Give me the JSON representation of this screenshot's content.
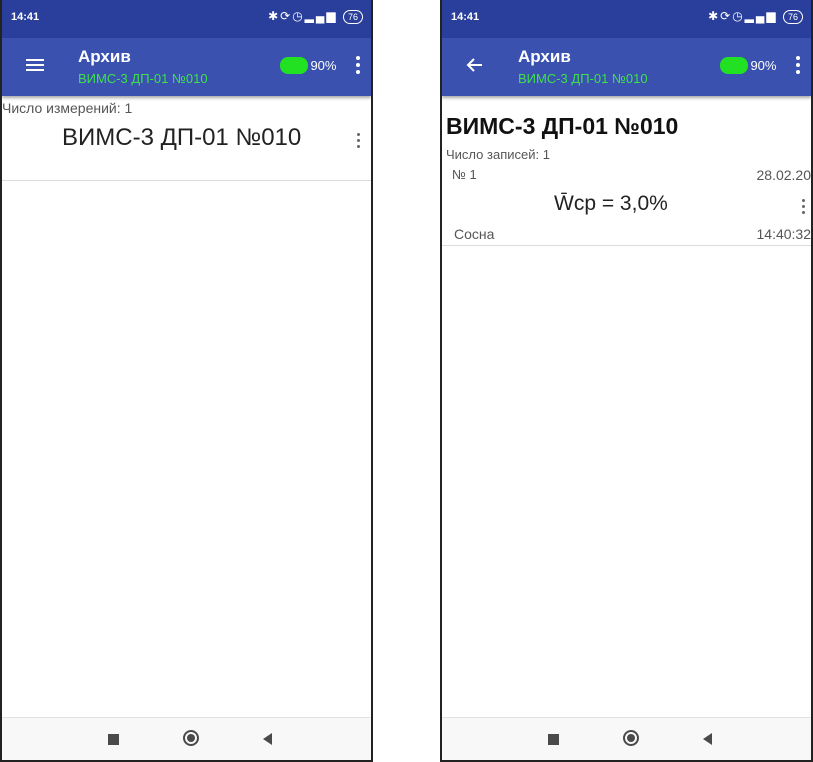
{
  "left_screen": {
    "status": {
      "time": "14:41",
      "battery": "76"
    },
    "appbar": {
      "title": "Архив",
      "subtitle": "ВИМС-3 ДП-01 №010",
      "battery_level": "90%"
    },
    "count_line": "Число измерений: 1",
    "devices": [
      {
        "name": "ВИМС-3 ДП-01 №010"
      }
    ]
  },
  "right_screen": {
    "status": {
      "time": "14:41",
      "battery": "76"
    },
    "appbar": {
      "title": "Архив",
      "subtitle": "ВИМС-3 ДП-01 №010",
      "battery_level": "90%"
    },
    "heading": "ВИМС-3 ДП-01 №010",
    "count_line": "Число записей: 1",
    "records": [
      {
        "number": "№ 1",
        "date": "28.02.20",
        "value": "W̄ср = 3,0%",
        "species": "Сосна",
        "time": "14:40:32"
      }
    ]
  },
  "icons": {
    "nav_menu": "hamburger-icon",
    "nav_back": "arrow-back-icon",
    "overflow": "more-vert-icon",
    "system": [
      "recents-icon",
      "home-icon",
      "back-icon"
    ],
    "status": [
      "bluetooth-icon",
      "sync-icon",
      "alarm-icon",
      "signal-icon"
    ]
  },
  "colors": {
    "status_bar": "#2a3f9c",
    "app_bar": "#3a51b0",
    "subtitle": "#3ee04b",
    "battery_indicator": "#22e022"
  }
}
